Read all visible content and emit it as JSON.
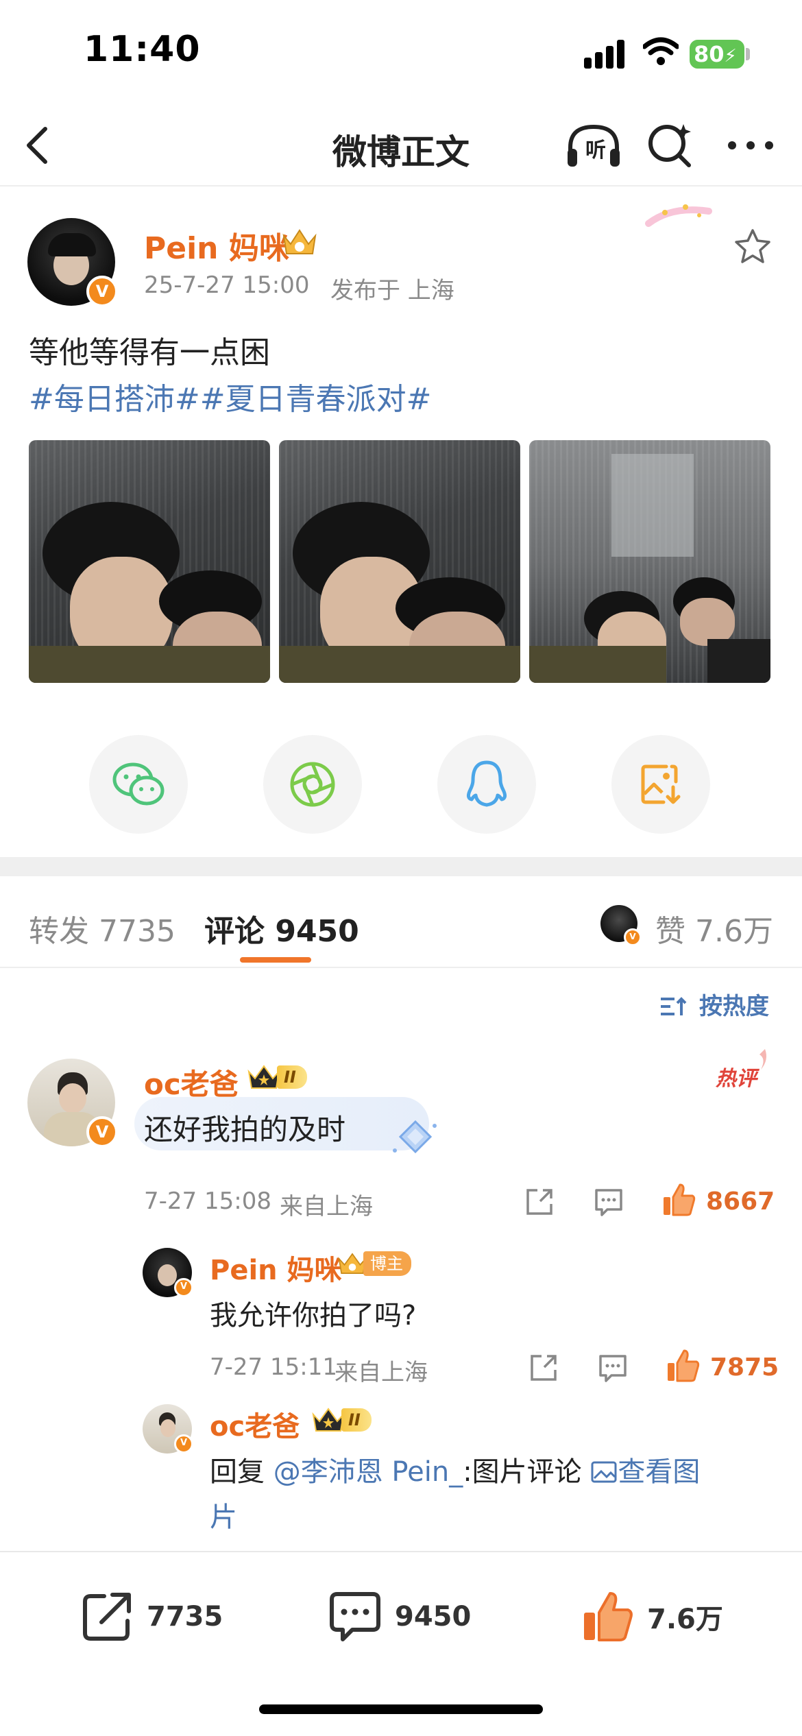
{
  "status_bar": {
    "time": "11:40",
    "battery": "80"
  },
  "nav": {
    "title": "微博正文",
    "listen_label": "听"
  },
  "post": {
    "author": "Pein 妈咪",
    "date": "25-7-27 15:00",
    "location": "发布于 上海",
    "text": "等他等得有一点困",
    "topics": "#每日搭沛##夏日青春派对#"
  },
  "tabs": {
    "repost_label": "转发",
    "repost_count": "7735",
    "comment_label": "评论",
    "comment_count": "9450",
    "like_label": "赞",
    "like_count": "7.6万"
  },
  "sort_label": "按热度",
  "comments": [
    {
      "user": "oc老爸",
      "rank": "II",
      "badge": "热评",
      "text": "还好我拍的及时",
      "time": "7-27 15:08",
      "source": "来自上海",
      "likes": "8667"
    }
  ],
  "replies": [
    {
      "user": "Pein 妈咪",
      "tag": "博主",
      "text": "我允许你拍了吗?",
      "time": "7-27 15:11",
      "source": "来自上海",
      "likes": "7875"
    },
    {
      "user": "oc老爸",
      "rank": "II",
      "reply_prefix": "回复",
      "mention": "@李沛恩 Pein_",
      "reply_suffix": ":图片评论",
      "view_image": "查看图",
      "view_image_cont": "片"
    }
  ],
  "bottom_bar": {
    "repost": "7735",
    "comment": "9450",
    "like": "7.6万"
  },
  "colors": {
    "accent": "#e86a1f",
    "link": "#4b77b3",
    "meta": "#8a8a8a"
  }
}
